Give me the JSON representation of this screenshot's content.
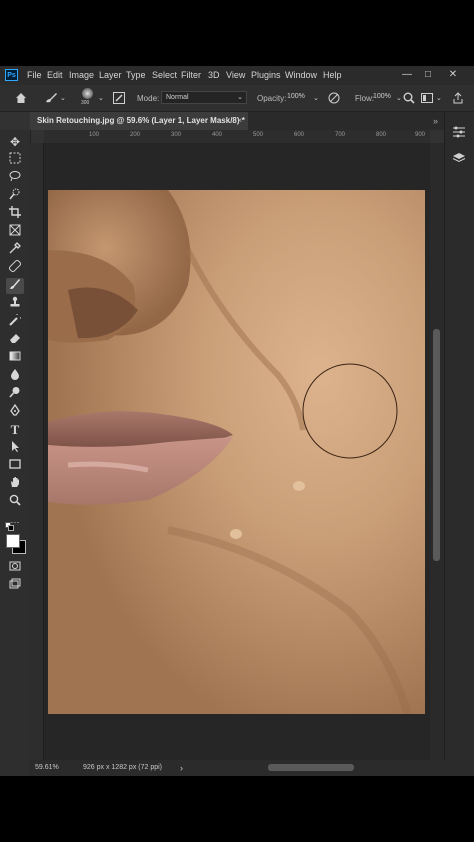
{
  "app": {
    "logo": "Ps",
    "menu": [
      "File",
      "Edit",
      "Image",
      "Layer",
      "Type",
      "Select",
      "Filter",
      "3D",
      "View",
      "Plugins",
      "Window",
      "Help"
    ],
    "window_controls": {
      "minimize": "—",
      "restore": "□",
      "close": "✕"
    }
  },
  "options_bar": {
    "brush_size": "300",
    "mode_label": "Mode:",
    "mode_value": "Normal",
    "opacity_label": "Opacity:",
    "opacity_value": "100%",
    "flow_label": "Flow:",
    "flow_value": "100%"
  },
  "document_tab": {
    "title": "Skin Retouching.jpg @ 59.6% (Layer 1, Layer Mask/8) *",
    "close": "×",
    "more": "»"
  },
  "ruler": {
    "ticks": [
      "100",
      "200",
      "300",
      "400",
      "500",
      "600",
      "700",
      "800",
      "900"
    ]
  },
  "status": {
    "zoom": "59.61%",
    "doc_info": "926 px x 1282 px (72 ppi)",
    "arrow": "›"
  },
  "icons": {
    "home": "home-icon",
    "brush_tool": "brush-icon",
    "airbrush": "airbrush-icon",
    "search": "search-icon",
    "workspace": "workspace-icon",
    "share": "share-icon",
    "properties": "properties-icon",
    "layers": "layers-icon"
  },
  "colors": {
    "app_bg": "#323232",
    "accent": "#31a8ff",
    "foreground_color": "#ffffff",
    "background_color": "#000000"
  }
}
